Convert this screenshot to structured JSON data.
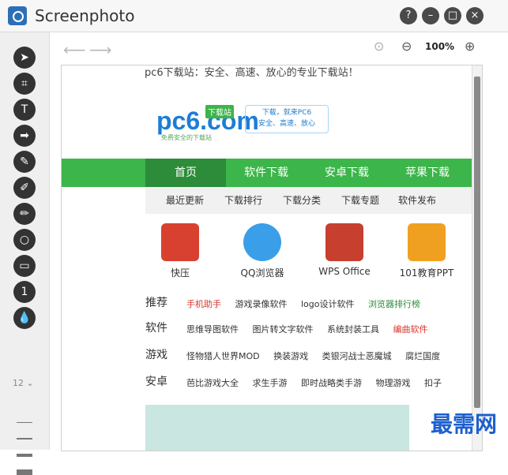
{
  "window": {
    "title": "Screenphoto",
    "buttons": [
      "?",
      "–",
      "□",
      "×"
    ]
  },
  "tools": [
    "arrow-icon",
    "crop-icon",
    "text-icon",
    "big-arrow-icon",
    "pen-icon",
    "marker-icon",
    "brush-icon",
    "ellipse-icon",
    "rectangle-icon",
    "number-icon",
    "blur-drop-icon"
  ],
  "tool_glyphs": [
    "➤",
    "⌗",
    "T",
    "➡",
    "✎",
    "✐",
    "✏",
    "○",
    "▭",
    "1",
    "💧"
  ],
  "size_select": "12 ⌄",
  "zoom": {
    "level": "100%",
    "minus": "⊖",
    "plus": "⊕",
    "fit": "⊙"
  },
  "web": {
    "top_note": "pc6下载站：安全、高速、放心的专业下载站！",
    "logo": {
      "main": "pc6.com",
      "tag": "下载站",
      "sub": "免费安全的下载站"
    },
    "slogan": [
      "下载，就来PC6",
      "安全、高速、放心"
    ],
    "main_nav": [
      "首页",
      "软件下载",
      "安卓下载",
      "苹果下载"
    ],
    "sub_nav": [
      "最近更新",
      "下载排行",
      "下载分类",
      "下载专题",
      "软件发布"
    ],
    "apps": [
      {
        "name": "快压",
        "color": "#d8412f"
      },
      {
        "name": "QQ浏览器",
        "color": "#3a9ee8"
      },
      {
        "name": "WPS Office",
        "color": "#c63f2f"
      },
      {
        "name": "101教育PPT",
        "color": "#f0a020"
      }
    ],
    "categories": [
      {
        "label": "推荐",
        "items": [
          "手机助手",
          "游戏录像软件",
          "logo设计软件",
          "浏览器排行榜"
        ]
      },
      {
        "label": "软件",
        "items": [
          "思维导图软件",
          "图片转文字软件",
          "系统封装工具",
          "编曲软件"
        ]
      },
      {
        "label": "游戏",
        "items": [
          "怪物猎人世界MOD",
          "换装游戏",
          "类银河战士恶魔城",
          "腐烂国度"
        ]
      },
      {
        "label": "安卓",
        "items": [
          "芭比游戏大全",
          "求生手游",
          "即时战略类手游",
          "物理游戏",
          "扣子"
        ]
      }
    ]
  },
  "watermark": "最需网"
}
